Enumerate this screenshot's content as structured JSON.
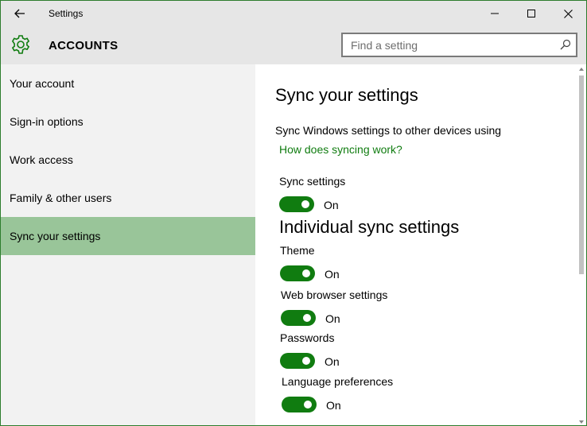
{
  "window": {
    "title": "Settings"
  },
  "header": {
    "section": "ACCOUNTS"
  },
  "search": {
    "placeholder": "Find a setting",
    "value": ""
  },
  "sidebar": {
    "items": [
      {
        "label": "Your account"
      },
      {
        "label": "Sign-in options"
      },
      {
        "label": "Work access"
      },
      {
        "label": "Family & other users"
      },
      {
        "label": "Sync your settings",
        "active": true
      }
    ]
  },
  "content": {
    "title": "Sync your settings",
    "description": "Sync Windows settings to other devices using",
    "help_link": "How does syncing work?",
    "sync_settings": {
      "label": "Sync settings",
      "state": "On"
    },
    "individual_heading": "Individual sync settings",
    "individual": [
      {
        "label": "Theme",
        "state": "On"
      },
      {
        "label": "Web browser settings",
        "state": "On"
      },
      {
        "label": "Passwords",
        "state": "On"
      },
      {
        "label": "Language preferences",
        "state": "On"
      }
    ]
  },
  "colors": {
    "accent": "#107c10",
    "active_nav": "#99c599",
    "window_border": "#2d7d2d"
  },
  "icons": {
    "back": "back-arrow-icon",
    "gear": "gear-icon",
    "search": "search-icon",
    "minimize": "minimize-icon",
    "maximize": "maximize-icon",
    "close": "close-icon"
  }
}
